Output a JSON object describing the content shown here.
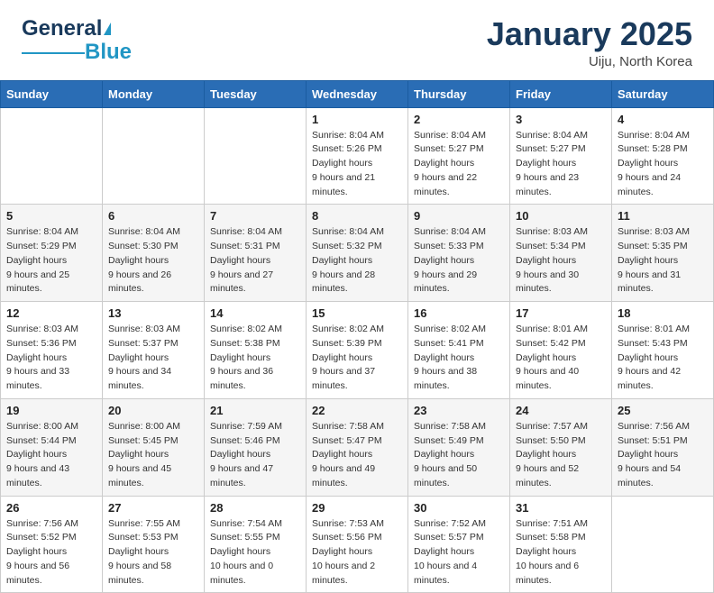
{
  "header": {
    "logo_general": "General",
    "logo_blue": "Blue",
    "month_title": "January 2025",
    "location": "Uiju, North Korea"
  },
  "days_of_week": [
    "Sunday",
    "Monday",
    "Tuesday",
    "Wednesday",
    "Thursday",
    "Friday",
    "Saturday"
  ],
  "weeks": [
    [
      {
        "day": "",
        "sunrise": "",
        "sunset": "",
        "daylight": ""
      },
      {
        "day": "",
        "sunrise": "",
        "sunset": "",
        "daylight": ""
      },
      {
        "day": "",
        "sunrise": "",
        "sunset": "",
        "daylight": ""
      },
      {
        "day": "1",
        "sunrise": "8:04 AM",
        "sunset": "5:26 PM",
        "daylight": "9 hours and 21 minutes."
      },
      {
        "day": "2",
        "sunrise": "8:04 AM",
        "sunset": "5:27 PM",
        "daylight": "9 hours and 22 minutes."
      },
      {
        "day": "3",
        "sunrise": "8:04 AM",
        "sunset": "5:27 PM",
        "daylight": "9 hours and 23 minutes."
      },
      {
        "day": "4",
        "sunrise": "8:04 AM",
        "sunset": "5:28 PM",
        "daylight": "9 hours and 24 minutes."
      }
    ],
    [
      {
        "day": "5",
        "sunrise": "8:04 AM",
        "sunset": "5:29 PM",
        "daylight": "9 hours and 25 minutes."
      },
      {
        "day": "6",
        "sunrise": "8:04 AM",
        "sunset": "5:30 PM",
        "daylight": "9 hours and 26 minutes."
      },
      {
        "day": "7",
        "sunrise": "8:04 AM",
        "sunset": "5:31 PM",
        "daylight": "9 hours and 27 minutes."
      },
      {
        "day": "8",
        "sunrise": "8:04 AM",
        "sunset": "5:32 PM",
        "daylight": "9 hours and 28 minutes."
      },
      {
        "day": "9",
        "sunrise": "8:04 AM",
        "sunset": "5:33 PM",
        "daylight": "9 hours and 29 minutes."
      },
      {
        "day": "10",
        "sunrise": "8:03 AM",
        "sunset": "5:34 PM",
        "daylight": "9 hours and 30 minutes."
      },
      {
        "day": "11",
        "sunrise": "8:03 AM",
        "sunset": "5:35 PM",
        "daylight": "9 hours and 31 minutes."
      }
    ],
    [
      {
        "day": "12",
        "sunrise": "8:03 AM",
        "sunset": "5:36 PM",
        "daylight": "9 hours and 33 minutes."
      },
      {
        "day": "13",
        "sunrise": "8:03 AM",
        "sunset": "5:37 PM",
        "daylight": "9 hours and 34 minutes."
      },
      {
        "day": "14",
        "sunrise": "8:02 AM",
        "sunset": "5:38 PM",
        "daylight": "9 hours and 36 minutes."
      },
      {
        "day": "15",
        "sunrise": "8:02 AM",
        "sunset": "5:39 PM",
        "daylight": "9 hours and 37 minutes."
      },
      {
        "day": "16",
        "sunrise": "8:02 AM",
        "sunset": "5:41 PM",
        "daylight": "9 hours and 38 minutes."
      },
      {
        "day": "17",
        "sunrise": "8:01 AM",
        "sunset": "5:42 PM",
        "daylight": "9 hours and 40 minutes."
      },
      {
        "day": "18",
        "sunrise": "8:01 AM",
        "sunset": "5:43 PM",
        "daylight": "9 hours and 42 minutes."
      }
    ],
    [
      {
        "day": "19",
        "sunrise": "8:00 AM",
        "sunset": "5:44 PM",
        "daylight": "9 hours and 43 minutes."
      },
      {
        "day": "20",
        "sunrise": "8:00 AM",
        "sunset": "5:45 PM",
        "daylight": "9 hours and 45 minutes."
      },
      {
        "day": "21",
        "sunrise": "7:59 AM",
        "sunset": "5:46 PM",
        "daylight": "9 hours and 47 minutes."
      },
      {
        "day": "22",
        "sunrise": "7:58 AM",
        "sunset": "5:47 PM",
        "daylight": "9 hours and 49 minutes."
      },
      {
        "day": "23",
        "sunrise": "7:58 AM",
        "sunset": "5:49 PM",
        "daylight": "9 hours and 50 minutes."
      },
      {
        "day": "24",
        "sunrise": "7:57 AM",
        "sunset": "5:50 PM",
        "daylight": "9 hours and 52 minutes."
      },
      {
        "day": "25",
        "sunrise": "7:56 AM",
        "sunset": "5:51 PM",
        "daylight": "9 hours and 54 minutes."
      }
    ],
    [
      {
        "day": "26",
        "sunrise": "7:56 AM",
        "sunset": "5:52 PM",
        "daylight": "9 hours and 56 minutes."
      },
      {
        "day": "27",
        "sunrise": "7:55 AM",
        "sunset": "5:53 PM",
        "daylight": "9 hours and 58 minutes."
      },
      {
        "day": "28",
        "sunrise": "7:54 AM",
        "sunset": "5:55 PM",
        "daylight": "10 hours and 0 minutes."
      },
      {
        "day": "29",
        "sunrise": "7:53 AM",
        "sunset": "5:56 PM",
        "daylight": "10 hours and 2 minutes."
      },
      {
        "day": "30",
        "sunrise": "7:52 AM",
        "sunset": "5:57 PM",
        "daylight": "10 hours and 4 minutes."
      },
      {
        "day": "31",
        "sunrise": "7:51 AM",
        "sunset": "5:58 PM",
        "daylight": "10 hours and 6 minutes."
      },
      {
        "day": "",
        "sunrise": "",
        "sunset": "",
        "daylight": ""
      }
    ]
  ]
}
